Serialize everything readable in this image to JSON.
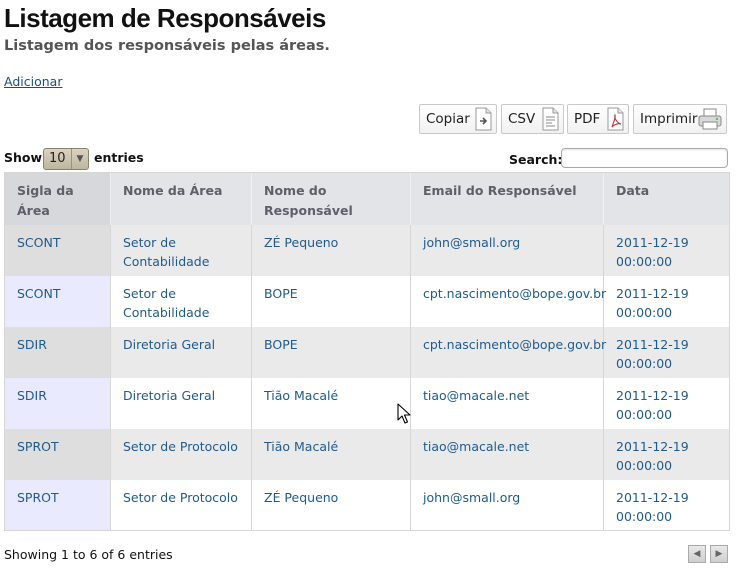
{
  "page": {
    "title": "Listagem de Responsáveis",
    "subtitle": "Listagem dos responsáveis pelas áreas.",
    "add_link": "Adicionar"
  },
  "toolbar": {
    "copy_label": "Copiar",
    "csv_label": "CSV",
    "pdf_label": "PDF",
    "print_label": "Imprimir",
    "icons": [
      "copy-icon",
      "csv-file-icon",
      "pdf-file-icon",
      "printer-icon"
    ]
  },
  "length_menu": {
    "show_label": "Show",
    "selected": "10",
    "entries_label": "entries"
  },
  "search": {
    "label": "Search:",
    "value": ""
  },
  "table": {
    "headers": [
      "Sigla da Área",
      "Nome da Área",
      "Nome do Responsável",
      "Email do Responsável",
      "Data"
    ],
    "rows": [
      [
        "SCONT",
        "Setor de Contabilidade",
        "ZÉ Pequeno",
        "john@small.org",
        "2011-12-19 00:00:00"
      ],
      [
        "SCONT",
        "Setor de Contabilidade",
        "BOPE",
        "cpt.nascimento@bope.gov.br",
        "2011-12-19 00:00:00"
      ],
      [
        "SDIR",
        "Diretoria Geral",
        "BOPE",
        "cpt.nascimento@bope.gov.br",
        "2011-12-19 00:00:00"
      ],
      [
        "SDIR",
        "Diretoria Geral",
        "Tião Macalé",
        "tiao@macale.net",
        "2011-12-19 00:00:00"
      ],
      [
        "SPROT",
        "Setor de Protocolo",
        "Tião Macalé",
        "tiao@macale.net",
        "2011-12-19 00:00:00"
      ],
      [
        "SPROT",
        "Setor de Protocolo",
        "ZÉ Pequeno",
        "john@small.org",
        "2011-12-19 00:00:00"
      ]
    ]
  },
  "footer": {
    "info": "Showing 1 to 6 of 6 entries",
    "pagination_icons": [
      "previous-page-icon",
      "next-page-icon"
    ]
  },
  "colors": {
    "link": "#1f5a8e",
    "header_bg": "#e2e4e8",
    "row_odd": "#eaeaea",
    "row_even_first_col": "#eaeaff"
  }
}
